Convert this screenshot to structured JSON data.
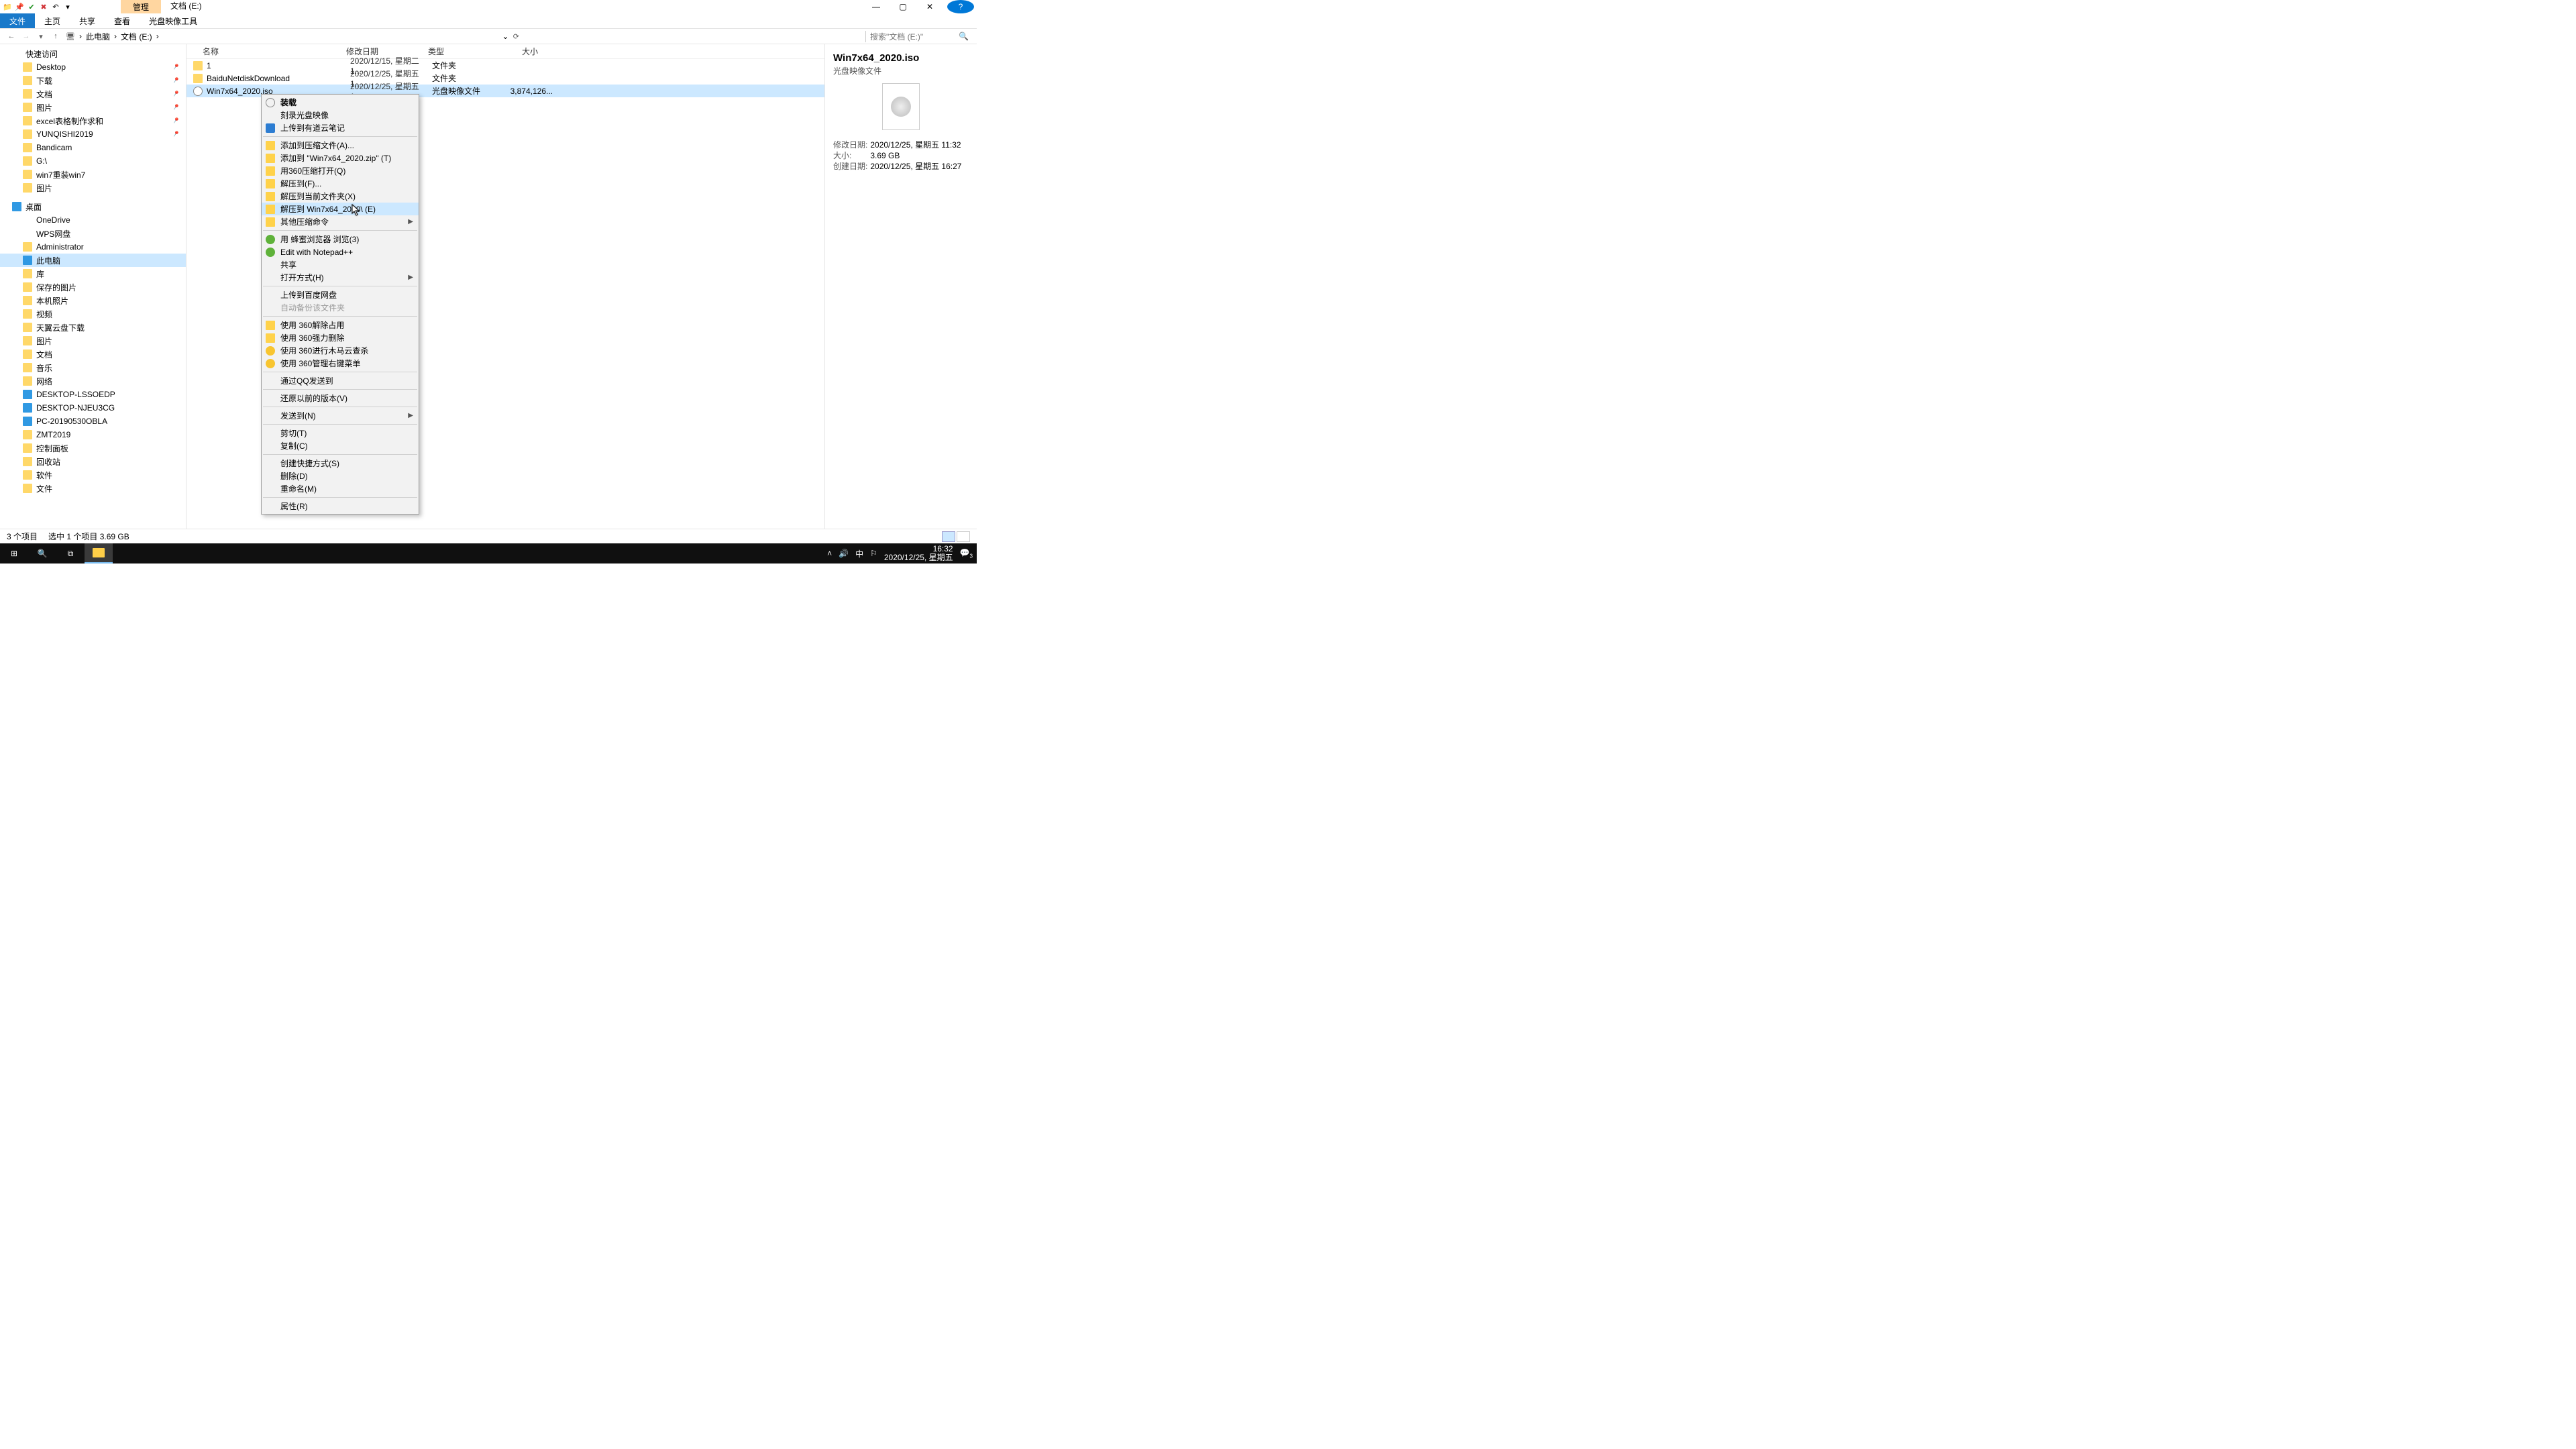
{
  "window": {
    "title": "文档 (E:)",
    "ctx_tab": "管理"
  },
  "ribbon": {
    "file": "文件",
    "tabs": [
      "主页",
      "共享",
      "查看"
    ],
    "tool": "光盘映像工具"
  },
  "wincontrols": {
    "min": "—",
    "max": "▢",
    "close": "✕",
    "help": "?"
  },
  "address": {
    "root": "此电脑",
    "path": "文档 (E:)",
    "search_placeholder": "搜索\"文档 (E:)\""
  },
  "nav_quick": {
    "header": "快速访问",
    "items": [
      {
        "label": "Desktop",
        "pin": true
      },
      {
        "label": "下载",
        "pin": true
      },
      {
        "label": "文档",
        "pin": true
      },
      {
        "label": "图片",
        "pin": true
      },
      {
        "label": "excel表格制作求和",
        "pin": true
      },
      {
        "label": "YUNQISHI2019",
        "pin": true
      },
      {
        "label": "Bandicam"
      },
      {
        "label": "G:\\"
      },
      {
        "label": "win7重装win7"
      },
      {
        "label": "图片"
      }
    ]
  },
  "nav_desktop": {
    "header": "桌面",
    "items": [
      "OneDrive",
      "WPS网盘",
      "Administrator",
      "此电脑",
      "库",
      "保存的图片",
      "本机照片",
      "视频",
      "天翼云盘下载",
      "图片",
      "文档",
      "音乐",
      "网络",
      "DESKTOP-LSSOEDP",
      "DESKTOP-NJEU3CG",
      "PC-20190530OBLA",
      "ZMT2019",
      "控制面板",
      "回收站",
      "软件",
      "文件"
    ]
  },
  "nav_selected": "此电脑",
  "list": {
    "cols": {
      "name": "名称",
      "date": "修改日期",
      "type": "类型",
      "size": "大小"
    },
    "rows": [
      {
        "name": "1",
        "date": "2020/12/15, 星期二 1...",
        "type": "文件夹",
        "size": "",
        "icon": "fold"
      },
      {
        "name": "BaiduNetdiskDownload",
        "date": "2020/12/25, 星期五 1...",
        "type": "文件夹",
        "size": "",
        "icon": "fold"
      },
      {
        "name": "Win7x64_2020.iso",
        "date": "2020/12/25, 星期五 1...",
        "type": "光盘映像文件",
        "size": "3,874,126...",
        "icon": "disc",
        "sel": true
      }
    ]
  },
  "preview": {
    "title": "Win7x64_2020.iso",
    "subtitle": "光盘映像文件",
    "meta": [
      {
        "label": "修改日期:",
        "value": "2020/12/25, 星期五 11:32"
      },
      {
        "label": "大小:",
        "value": "3.69 GB"
      },
      {
        "label": "创建日期:",
        "value": "2020/12/25, 星期五 16:27"
      }
    ]
  },
  "status": {
    "count": "3 个项目",
    "selected": "选中 1 个项目  3.69 GB"
  },
  "context_menu": [
    {
      "label": "装载",
      "bold": true,
      "icon": "disc"
    },
    {
      "label": "刻录光盘映像"
    },
    {
      "label": "上传到有道云笔记",
      "icon": "blue"
    },
    {
      "sep": true
    },
    {
      "label": "添加到压缩文件(A)...",
      "icon": "box"
    },
    {
      "label": "添加到 \"Win7x64_2020.zip\" (T)",
      "icon": "box"
    },
    {
      "label": "用360压缩打开(Q)",
      "icon": "box"
    },
    {
      "label": "解压到(F)...",
      "icon": "box"
    },
    {
      "label": "解压到当前文件夹(X)",
      "icon": "box"
    },
    {
      "label": "解压到 Win7x64_2020\\ (E)",
      "icon": "box",
      "hov": true
    },
    {
      "label": "其他压缩命令",
      "icon": "box",
      "submenu": true
    },
    {
      "sep": true
    },
    {
      "label": "用 蜂蜜浏览器 浏览(3)",
      "icon": "green"
    },
    {
      "label": "Edit with Notepad++",
      "icon": "green"
    },
    {
      "label": "共享"
    },
    {
      "label": "打开方式(H)",
      "submenu": true
    },
    {
      "sep": true
    },
    {
      "label": "上传到百度网盘"
    },
    {
      "label": "自动备份该文件夹",
      "disabled": true
    },
    {
      "sep": true
    },
    {
      "label": "使用 360解除占用",
      "icon": "box"
    },
    {
      "label": "使用 360强力删除",
      "icon": "box"
    },
    {
      "label": "使用 360进行木马云查杀",
      "icon": "yellow"
    },
    {
      "label": "使用 360管理右键菜单",
      "icon": "yellow"
    },
    {
      "sep": true
    },
    {
      "label": "通过QQ发送到"
    },
    {
      "sep": true
    },
    {
      "label": "还原以前的版本(V)"
    },
    {
      "sep": true
    },
    {
      "label": "发送到(N)",
      "submenu": true
    },
    {
      "sep": true
    },
    {
      "label": "剪切(T)"
    },
    {
      "label": "复制(C)"
    },
    {
      "sep": true
    },
    {
      "label": "创建快捷方式(S)"
    },
    {
      "label": "删除(D)"
    },
    {
      "label": "重命名(M)"
    },
    {
      "sep": true
    },
    {
      "label": "属性(R)"
    }
  ],
  "taskbar": {
    "time": "16:32",
    "date": "2020/12/25, 星期五",
    "ime": "中",
    "notif": "3"
  }
}
